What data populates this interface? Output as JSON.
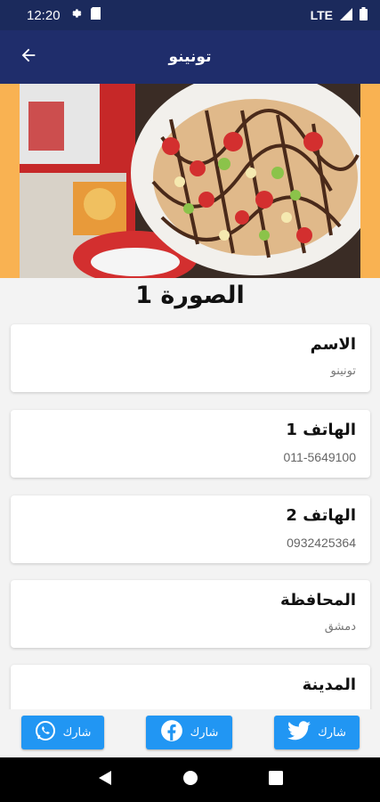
{
  "status_bar": {
    "time": "12:20",
    "network": "LTE"
  },
  "app_bar": {
    "title": "تونينو"
  },
  "image": {
    "caption": "الصورة 1"
  },
  "fields": [
    {
      "label": "الاسم",
      "value": "تونينو"
    },
    {
      "label": "الهاتف 1",
      "value": "011-5649100"
    },
    {
      "label": "الهاتف 2",
      "value": "0932425364"
    },
    {
      "label": "المحافظة",
      "value": "دمشق"
    },
    {
      "label": "المدينة",
      "value": ""
    }
  ],
  "share": {
    "whatsapp_label": "شارك",
    "facebook_label": "شارك",
    "twitter_label": "شارك"
  },
  "colors": {
    "status_bar": "#1b2a5c",
    "app_bar": "#1f2d6b",
    "share_button": "#2196f3",
    "hero_background": "#f9b252"
  },
  "icons": {
    "back": "arrow-left-icon",
    "whatsapp": "whatsapp-icon",
    "facebook": "facebook-icon",
    "twitter": "twitter-icon"
  }
}
